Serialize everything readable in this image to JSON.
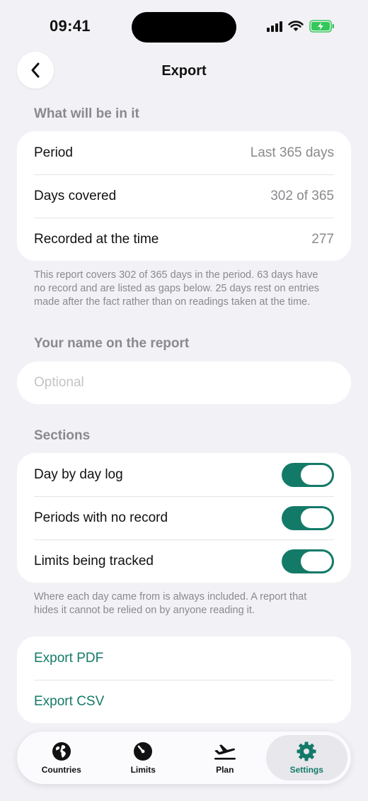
{
  "status_bar": {
    "time": "09:41"
  },
  "nav": {
    "title": "Export"
  },
  "summary": {
    "header": "What will be in it",
    "rows": [
      {
        "label": "Period",
        "value": "Last 365 days"
      },
      {
        "label": "Days covered",
        "value": "302 of 365"
      },
      {
        "label": "Recorded at the time",
        "value": "277"
      }
    ],
    "footnote": "This report covers 302 of 365 days in the period. 63 days have no record and are listed as gaps below. 25 days rest on entries made after the fact rather than on readings taken at the time."
  },
  "name": {
    "header": "Your name on the report",
    "placeholder": "Optional",
    "value": ""
  },
  "sections": {
    "header": "Sections",
    "items": [
      {
        "label": "Day by day log",
        "on": true
      },
      {
        "label": "Periods with no record",
        "on": true
      },
      {
        "label": "Limits being tracked",
        "on": true
      }
    ],
    "footnote": "Where each day came from is always included. A report that hides it cannot be relied on by anyone reading it."
  },
  "actions": {
    "export_pdf": "Export PDF",
    "export_csv": "Export CSV"
  },
  "tabs": [
    {
      "label": "Countries",
      "icon": "globe-icon"
    },
    {
      "label": "Limits",
      "icon": "gauge-icon"
    },
    {
      "label": "Plan",
      "icon": "plane-icon"
    },
    {
      "label": "Settings",
      "icon": "gear-icon",
      "active": true
    }
  ],
  "colors": {
    "accent": "#147a68",
    "background": "#f2f2f6",
    "secondary_text": "#8a8a8e"
  }
}
